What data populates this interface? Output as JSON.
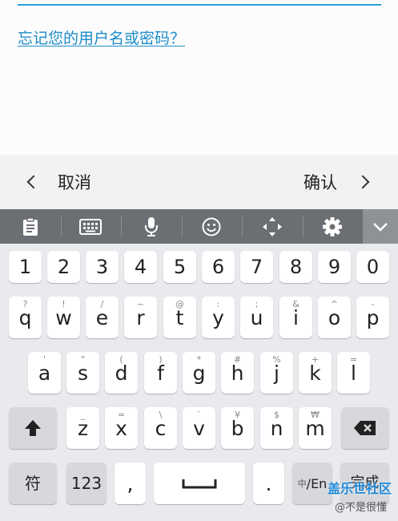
{
  "form": {
    "forgot_link": "忘记您的用户名或密码？"
  },
  "nav": {
    "cancel_label": "取消",
    "confirm_label": "确认"
  },
  "toolbar": {
    "icons": [
      "clipboard-icon",
      "keyboard-icon",
      "microphone-icon",
      "emoji-icon",
      "cursor-move-icon",
      "settings-gear-icon",
      "chevron-down-icon"
    ]
  },
  "keyboard": {
    "number_row": [
      "1",
      "2",
      "3",
      "4",
      "5",
      "6",
      "7",
      "8",
      "9",
      "0"
    ],
    "row1": [
      {
        "main": "q",
        "sub": "?"
      },
      {
        "main": "w",
        "sub": "!"
      },
      {
        "main": "e",
        "sub": "/"
      },
      {
        "main": "r",
        "sub": "~"
      },
      {
        "main": "t",
        "sub": "@"
      },
      {
        "main": "y",
        "sub": ":"
      },
      {
        "main": "u",
        "sub": ";"
      },
      {
        "main": "i",
        "sub": "&"
      },
      {
        "main": "o",
        "sub": "^"
      },
      {
        "main": "p",
        "sub": "-"
      }
    ],
    "row2": [
      {
        "main": "a",
        "sub": "'"
      },
      {
        "main": "s",
        "sub": "\""
      },
      {
        "main": "d",
        "sub": "("
      },
      {
        "main": "f",
        "sub": ")"
      },
      {
        "main": "g",
        "sub": "*"
      },
      {
        "main": "h",
        "sub": "#"
      },
      {
        "main": "j",
        "sub": "%"
      },
      {
        "main": "k",
        "sub": "+"
      },
      {
        "main": "l",
        "sub": "="
      }
    ],
    "row3": [
      {
        "main": "z",
        "sub": "_"
      },
      {
        "main": "x",
        "sub": "="
      },
      {
        "main": "c",
        "sub": "\\"
      },
      {
        "main": "v",
        "sub": "`"
      },
      {
        "main": "b",
        "sub": "¥"
      },
      {
        "main": "n",
        "sub": "$"
      },
      {
        "main": "m",
        "sub": "₩"
      }
    ],
    "bottom": {
      "symbols": "符",
      "numbers": "123",
      "comma": ",",
      "period": ".",
      "lang_prefix": "中",
      "lang_main": "/En",
      "done": "完成"
    }
  },
  "watermark": {
    "line1": "盖乐世社区",
    "line2": "@不是很懂"
  },
  "colors": {
    "accent": "#1d8cc9",
    "toolbar_bg": "#6b6e72",
    "keyboard_bg": "#e8eaed"
  }
}
